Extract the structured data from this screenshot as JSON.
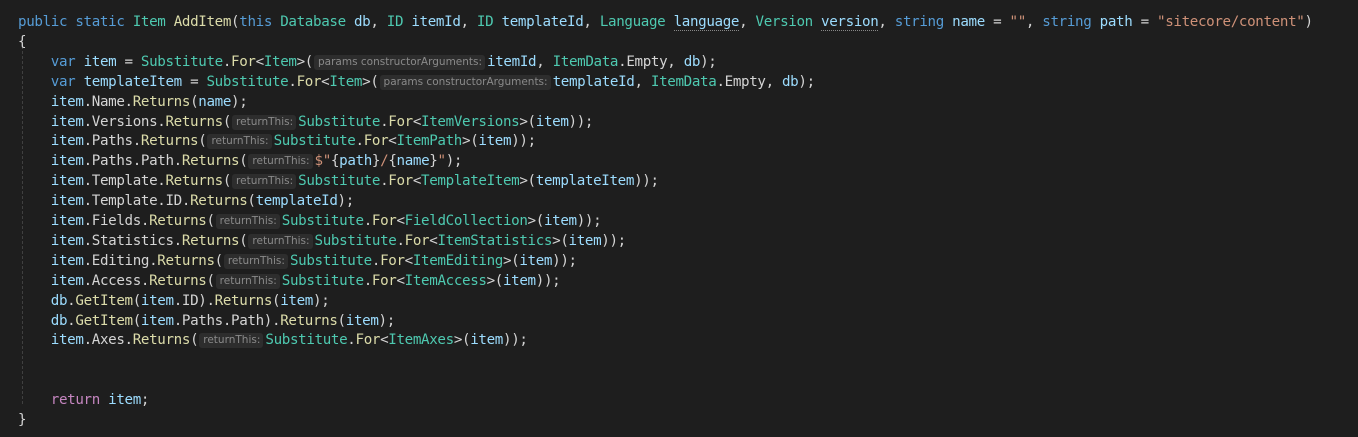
{
  "colors": {
    "background": "#1e1e1e",
    "keyword": "#569cd6",
    "type": "#4ec9b0",
    "method": "#dcdcaa",
    "variable": "#9cdcfe",
    "punctuation": "#d4d4d4",
    "string": "#ce9178",
    "control": "#c586c0",
    "inlay_hint_bg": "#2d2d2d",
    "inlay_hint_fg": "#8a8a8a",
    "indent_guide": "#404040"
  },
  "code": {
    "lines": [
      [
        {
          "text": "public",
          "kind": "kw"
        },
        {
          "text": " ",
          "kind": "pn"
        },
        {
          "text": "static",
          "kind": "kw"
        },
        {
          "text": " ",
          "kind": "pn"
        },
        {
          "text": "Item",
          "kind": "ty"
        },
        {
          "text": " ",
          "kind": "pn"
        },
        {
          "text": "AddItem",
          "kind": "fn"
        },
        {
          "text": "(",
          "kind": "pn"
        },
        {
          "text": "this",
          "kind": "kw"
        },
        {
          "text": " ",
          "kind": "pn"
        },
        {
          "text": "Database",
          "kind": "ty"
        },
        {
          "text": " ",
          "kind": "pn"
        },
        {
          "text": "db",
          "kind": "va"
        },
        {
          "text": ", ",
          "kind": "pn"
        },
        {
          "text": "ID",
          "kind": "ty"
        },
        {
          "text": " ",
          "kind": "pn"
        },
        {
          "text": "itemId",
          "kind": "va"
        },
        {
          "text": ", ",
          "kind": "pn"
        },
        {
          "text": "ID",
          "kind": "ty"
        },
        {
          "text": " ",
          "kind": "pn"
        },
        {
          "text": "templateId",
          "kind": "va"
        },
        {
          "text": ", ",
          "kind": "pn"
        },
        {
          "text": "Language",
          "kind": "ty"
        },
        {
          "text": " ",
          "kind": "pn"
        },
        {
          "text": "language",
          "kind": "dot"
        },
        {
          "text": ", ",
          "kind": "pn"
        },
        {
          "text": "Version",
          "kind": "ty"
        },
        {
          "text": " ",
          "kind": "pn"
        },
        {
          "text": "version",
          "kind": "dot"
        },
        {
          "text": ", ",
          "kind": "pn"
        },
        {
          "text": "string",
          "kind": "kw"
        },
        {
          "text": " ",
          "kind": "pn"
        },
        {
          "text": "name",
          "kind": "va"
        },
        {
          "text": " = ",
          "kind": "pn"
        },
        {
          "text": "\"\"",
          "kind": "st"
        },
        {
          "text": ", ",
          "kind": "pn"
        },
        {
          "text": "string",
          "kind": "kw"
        },
        {
          "text": " ",
          "kind": "pn"
        },
        {
          "text": "path",
          "kind": "va"
        },
        {
          "text": " = ",
          "kind": "pn"
        },
        {
          "text": "\"sitecore/content\"",
          "kind": "st"
        },
        {
          "text": ")",
          "kind": "pn"
        }
      ],
      [
        {
          "text": "{",
          "kind": "pn"
        }
      ],
      [
        {
          "text": "    ",
          "kind": "pn"
        },
        {
          "text": "var",
          "kind": "kw"
        },
        {
          "text": " ",
          "kind": "pn"
        },
        {
          "text": "item",
          "kind": "va"
        },
        {
          "text": " = ",
          "kind": "pn"
        },
        {
          "text": "Substitute",
          "kind": "ty"
        },
        {
          "text": ".",
          "kind": "pn"
        },
        {
          "text": "For",
          "kind": "fn"
        },
        {
          "text": "<",
          "kind": "pn"
        },
        {
          "text": "Item",
          "kind": "ty"
        },
        {
          "text": ">(",
          "kind": "pn"
        },
        {
          "text": "params constructorArguments:",
          "kind": "hint"
        },
        {
          "text": "itemId",
          "kind": "va"
        },
        {
          "text": ", ",
          "kind": "pn"
        },
        {
          "text": "ItemData",
          "kind": "ty"
        },
        {
          "text": ".Empty, ",
          "kind": "pn"
        },
        {
          "text": "db",
          "kind": "va"
        },
        {
          "text": ");",
          "kind": "pn"
        }
      ],
      [
        {
          "text": "    ",
          "kind": "pn"
        },
        {
          "text": "var",
          "kind": "kw"
        },
        {
          "text": " ",
          "kind": "pn"
        },
        {
          "text": "templateItem",
          "kind": "va"
        },
        {
          "text": " = ",
          "kind": "pn"
        },
        {
          "text": "Substitute",
          "kind": "ty"
        },
        {
          "text": ".",
          "kind": "pn"
        },
        {
          "text": "For",
          "kind": "fn"
        },
        {
          "text": "<",
          "kind": "pn"
        },
        {
          "text": "Item",
          "kind": "ty"
        },
        {
          "text": ">(",
          "kind": "pn"
        },
        {
          "text": "params constructorArguments:",
          "kind": "hint"
        },
        {
          "text": "templateId",
          "kind": "va"
        },
        {
          "text": ", ",
          "kind": "pn"
        },
        {
          "text": "ItemData",
          "kind": "ty"
        },
        {
          "text": ".Empty, ",
          "kind": "pn"
        },
        {
          "text": "db",
          "kind": "va"
        },
        {
          "text": ");",
          "kind": "pn"
        }
      ],
      [
        {
          "text": "    ",
          "kind": "pn"
        },
        {
          "text": "item",
          "kind": "va"
        },
        {
          "text": ".Name.",
          "kind": "pn"
        },
        {
          "text": "Returns",
          "kind": "fn"
        },
        {
          "text": "(",
          "kind": "pn"
        },
        {
          "text": "name",
          "kind": "va"
        },
        {
          "text": ");",
          "kind": "pn"
        }
      ],
      [
        {
          "text": "    ",
          "kind": "pn"
        },
        {
          "text": "item",
          "kind": "va"
        },
        {
          "text": ".Versions.",
          "kind": "pn"
        },
        {
          "text": "Returns",
          "kind": "fn"
        },
        {
          "text": "(",
          "kind": "pn"
        },
        {
          "text": "returnThis:",
          "kind": "hint"
        },
        {
          "text": "Substitute",
          "kind": "ty"
        },
        {
          "text": ".",
          "kind": "pn"
        },
        {
          "text": "For",
          "kind": "fn"
        },
        {
          "text": "<",
          "kind": "pn"
        },
        {
          "text": "ItemVersions",
          "kind": "ty"
        },
        {
          "text": ">(",
          "kind": "pn"
        },
        {
          "text": "item",
          "kind": "va"
        },
        {
          "text": "));",
          "kind": "pn"
        }
      ],
      [
        {
          "text": "    ",
          "kind": "pn"
        },
        {
          "text": "item",
          "kind": "va"
        },
        {
          "text": ".Paths.",
          "kind": "pn"
        },
        {
          "text": "Returns",
          "kind": "fn"
        },
        {
          "text": "(",
          "kind": "pn"
        },
        {
          "text": "returnThis:",
          "kind": "hint"
        },
        {
          "text": "Substitute",
          "kind": "ty"
        },
        {
          "text": ".",
          "kind": "pn"
        },
        {
          "text": "For",
          "kind": "fn"
        },
        {
          "text": "<",
          "kind": "pn"
        },
        {
          "text": "ItemPath",
          "kind": "ty"
        },
        {
          "text": ">(",
          "kind": "pn"
        },
        {
          "text": "item",
          "kind": "va"
        },
        {
          "text": "));",
          "kind": "pn"
        }
      ],
      [
        {
          "text": "    ",
          "kind": "pn"
        },
        {
          "text": "item",
          "kind": "va"
        },
        {
          "text": ".Paths.Path.",
          "kind": "pn"
        },
        {
          "text": "Returns",
          "kind": "fn"
        },
        {
          "text": "(",
          "kind": "pn"
        },
        {
          "text": "returnThis:",
          "kind": "hint"
        },
        {
          "text": "$\"",
          "kind": "st"
        },
        {
          "text": "{",
          "kind": "pn"
        },
        {
          "text": "path",
          "kind": "va"
        },
        {
          "text": "}",
          "kind": "pn"
        },
        {
          "text": "/",
          "kind": "st"
        },
        {
          "text": "{",
          "kind": "pn"
        },
        {
          "text": "name",
          "kind": "va"
        },
        {
          "text": "}",
          "kind": "pn"
        },
        {
          "text": "\"",
          "kind": "st"
        },
        {
          "text": ");",
          "kind": "pn"
        }
      ],
      [
        {
          "text": "    ",
          "kind": "pn"
        },
        {
          "text": "item",
          "kind": "va"
        },
        {
          "text": ".Template.",
          "kind": "pn"
        },
        {
          "text": "Returns",
          "kind": "fn"
        },
        {
          "text": "(",
          "kind": "pn"
        },
        {
          "text": "returnThis:",
          "kind": "hint"
        },
        {
          "text": "Substitute",
          "kind": "ty"
        },
        {
          "text": ".",
          "kind": "pn"
        },
        {
          "text": "For",
          "kind": "fn"
        },
        {
          "text": "<",
          "kind": "pn"
        },
        {
          "text": "TemplateItem",
          "kind": "ty"
        },
        {
          "text": ">(",
          "kind": "pn"
        },
        {
          "text": "templateItem",
          "kind": "va"
        },
        {
          "text": "));",
          "kind": "pn"
        }
      ],
      [
        {
          "text": "    ",
          "kind": "pn"
        },
        {
          "text": "item",
          "kind": "va"
        },
        {
          "text": ".Template.ID.",
          "kind": "pn"
        },
        {
          "text": "Returns",
          "kind": "fn"
        },
        {
          "text": "(",
          "kind": "pn"
        },
        {
          "text": "templateId",
          "kind": "va"
        },
        {
          "text": ");",
          "kind": "pn"
        }
      ],
      [
        {
          "text": "    ",
          "kind": "pn"
        },
        {
          "text": "item",
          "kind": "va"
        },
        {
          "text": ".Fields.",
          "kind": "pn"
        },
        {
          "text": "Returns",
          "kind": "fn"
        },
        {
          "text": "(",
          "kind": "pn"
        },
        {
          "text": "returnThis:",
          "kind": "hint"
        },
        {
          "text": "Substitute",
          "kind": "ty"
        },
        {
          "text": ".",
          "kind": "pn"
        },
        {
          "text": "For",
          "kind": "fn"
        },
        {
          "text": "<",
          "kind": "pn"
        },
        {
          "text": "FieldCollection",
          "kind": "ty"
        },
        {
          "text": ">(",
          "kind": "pn"
        },
        {
          "text": "item",
          "kind": "va"
        },
        {
          "text": "));",
          "kind": "pn"
        }
      ],
      [
        {
          "text": "    ",
          "kind": "pn"
        },
        {
          "text": "item",
          "kind": "va"
        },
        {
          "text": ".Statistics.",
          "kind": "pn"
        },
        {
          "text": "Returns",
          "kind": "fn"
        },
        {
          "text": "(",
          "kind": "pn"
        },
        {
          "text": "returnThis:",
          "kind": "hint"
        },
        {
          "text": "Substitute",
          "kind": "ty"
        },
        {
          "text": ".",
          "kind": "pn"
        },
        {
          "text": "For",
          "kind": "fn"
        },
        {
          "text": "<",
          "kind": "pn"
        },
        {
          "text": "ItemStatistics",
          "kind": "ty"
        },
        {
          "text": ">(",
          "kind": "pn"
        },
        {
          "text": "item",
          "kind": "va"
        },
        {
          "text": "));",
          "kind": "pn"
        }
      ],
      [
        {
          "text": "    ",
          "kind": "pn"
        },
        {
          "text": "item",
          "kind": "va"
        },
        {
          "text": ".Editing.",
          "kind": "pn"
        },
        {
          "text": "Returns",
          "kind": "fn"
        },
        {
          "text": "(",
          "kind": "pn"
        },
        {
          "text": "returnThis:",
          "kind": "hint"
        },
        {
          "text": "Substitute",
          "kind": "ty"
        },
        {
          "text": ".",
          "kind": "pn"
        },
        {
          "text": "For",
          "kind": "fn"
        },
        {
          "text": "<",
          "kind": "pn"
        },
        {
          "text": "ItemEditing",
          "kind": "ty"
        },
        {
          "text": ">(",
          "kind": "pn"
        },
        {
          "text": "item",
          "kind": "va"
        },
        {
          "text": "));",
          "kind": "pn"
        }
      ],
      [
        {
          "text": "    ",
          "kind": "pn"
        },
        {
          "text": "item",
          "kind": "va"
        },
        {
          "text": ".Access.",
          "kind": "pn"
        },
        {
          "text": "Returns",
          "kind": "fn"
        },
        {
          "text": "(",
          "kind": "pn"
        },
        {
          "text": "returnThis:",
          "kind": "hint"
        },
        {
          "text": "Substitute",
          "kind": "ty"
        },
        {
          "text": ".",
          "kind": "pn"
        },
        {
          "text": "For",
          "kind": "fn"
        },
        {
          "text": "<",
          "kind": "pn"
        },
        {
          "text": "ItemAccess",
          "kind": "ty"
        },
        {
          "text": ">(",
          "kind": "pn"
        },
        {
          "text": "item",
          "kind": "va"
        },
        {
          "text": "));",
          "kind": "pn"
        }
      ],
      [
        {
          "text": "    ",
          "kind": "pn"
        },
        {
          "text": "db",
          "kind": "va"
        },
        {
          "text": ".",
          "kind": "pn"
        },
        {
          "text": "GetItem",
          "kind": "fn"
        },
        {
          "text": "(",
          "kind": "pn"
        },
        {
          "text": "item",
          "kind": "va"
        },
        {
          "text": ".ID).",
          "kind": "pn"
        },
        {
          "text": "Returns",
          "kind": "fn"
        },
        {
          "text": "(",
          "kind": "pn"
        },
        {
          "text": "item",
          "kind": "va"
        },
        {
          "text": ");",
          "kind": "pn"
        }
      ],
      [
        {
          "text": "    ",
          "kind": "pn"
        },
        {
          "text": "db",
          "kind": "va"
        },
        {
          "text": ".",
          "kind": "pn"
        },
        {
          "text": "GetItem",
          "kind": "fn"
        },
        {
          "text": "(",
          "kind": "pn"
        },
        {
          "text": "item",
          "kind": "va"
        },
        {
          "text": ".Paths.Path).",
          "kind": "pn"
        },
        {
          "text": "Returns",
          "kind": "fn"
        },
        {
          "text": "(",
          "kind": "pn"
        },
        {
          "text": "item",
          "kind": "va"
        },
        {
          "text": ");",
          "kind": "pn"
        }
      ],
      [
        {
          "text": "    ",
          "kind": "pn"
        },
        {
          "text": "item",
          "kind": "va"
        },
        {
          "text": ".Axes.",
          "kind": "pn"
        },
        {
          "text": "Returns",
          "kind": "fn"
        },
        {
          "text": "(",
          "kind": "pn"
        },
        {
          "text": "returnThis:",
          "kind": "hint"
        },
        {
          "text": "Substitute",
          "kind": "ty"
        },
        {
          "text": ".",
          "kind": "pn"
        },
        {
          "text": "For",
          "kind": "fn"
        },
        {
          "text": "<",
          "kind": "pn"
        },
        {
          "text": "ItemAxes",
          "kind": "ty"
        },
        {
          "text": ">(",
          "kind": "pn"
        },
        {
          "text": "item",
          "kind": "va"
        },
        {
          "text": "));",
          "kind": "pn"
        }
      ],
      [],
      [],
      [
        {
          "text": "    ",
          "kind": "pn"
        },
        {
          "text": "return",
          "kind": "ctl"
        },
        {
          "text": " ",
          "kind": "pn"
        },
        {
          "text": "item",
          "kind": "va"
        },
        {
          "text": ";",
          "kind": "pn"
        }
      ],
      [
        {
          "text": "}",
          "kind": "pn"
        }
      ]
    ]
  }
}
